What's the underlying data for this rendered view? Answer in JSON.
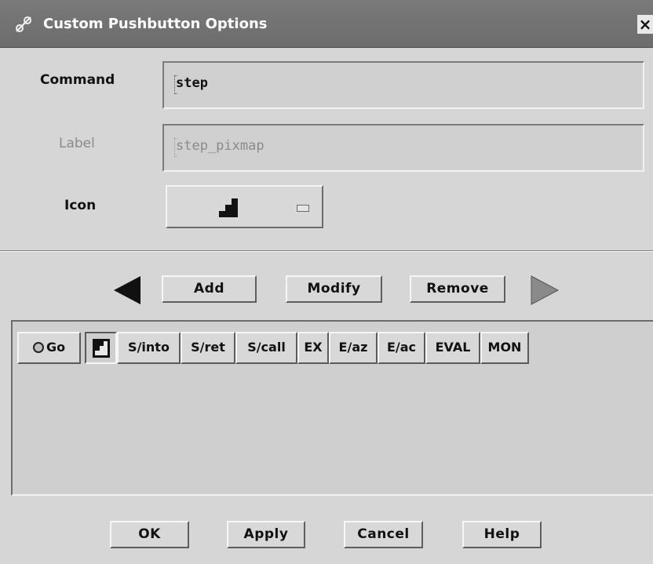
{
  "window": {
    "title": "Custom Pushbutton Options",
    "close_label": "×"
  },
  "form": {
    "command_label": "Command",
    "command_value": "step",
    "label_label": "Label",
    "label_value": "step_pixmap",
    "icon_label": "Icon",
    "icon_name": "step-stairs-icon"
  },
  "actions": {
    "add": "Add",
    "modify": "Modify",
    "remove": "Remove"
  },
  "palette": {
    "buttons": [
      {
        "label": "Go",
        "icon": "circle-icon"
      },
      {
        "label": "",
        "icon": "step-stairs-icon"
      },
      {
        "label": "S/into"
      },
      {
        "label": "S/ret"
      },
      {
        "label": "S/call"
      },
      {
        "label": "EX"
      },
      {
        "label": "E/az"
      },
      {
        "label": "E/ac"
      },
      {
        "label": "EVAL"
      },
      {
        "label": "MON"
      }
    ]
  },
  "footer": {
    "ok": "OK",
    "apply": "Apply",
    "cancel": "Cancel",
    "help": "Help"
  },
  "colors": {
    "titlebar": "#727272",
    "background": "#d6d6d6",
    "disabled_text": "#8a8a8a"
  }
}
